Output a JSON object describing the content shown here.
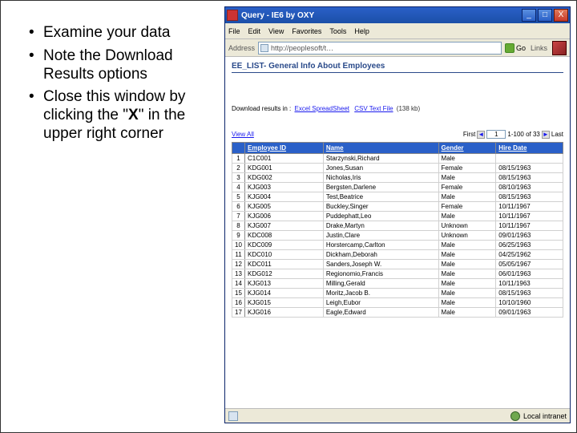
{
  "bullets": [
    "Examine your data",
    "Note the Download Results options",
    "Close this window by clicking the \"<b>X</b>\" in the upper right corner"
  ],
  "window": {
    "title": "Query - IE6 by OXY",
    "menu": [
      "File",
      "Edit",
      "View",
      "Favorites",
      "Tools",
      "Help"
    ],
    "addr_label": "Address",
    "url": "http://peoplesoft/t…",
    "go_label": "Go",
    "links_label": "Links"
  },
  "page": {
    "heading": "EE_LIST- General Info About Employees",
    "download_prefix": "Download results in :",
    "download_links": [
      "Excel SpreadSheet",
      "CSV Text File"
    ],
    "download_size": "(138 kb)",
    "view_all": "View All",
    "nav_label_first": "First",
    "nav_page_input": "1",
    "nav_range": "1-100 of 33",
    "nav_label_last": "Last",
    "columns": [
      "Employee ID",
      "Name",
      "Gender",
      "Hire Date"
    ],
    "rows": [
      {
        "n": 1,
        "id": "C1C001",
        "name": "Starzynski,Richard",
        "gender": "Male",
        "hire": ""
      },
      {
        "n": 2,
        "id": "KDG001",
        "name": "Jones,Susan",
        "gender": "Female",
        "hire": "08/15/1963"
      },
      {
        "n": 3,
        "id": "KDG002",
        "name": "Nicholas,Iris",
        "gender": "Male",
        "hire": "08/15/1963"
      },
      {
        "n": 4,
        "id": "KJG003",
        "name": "Bergsten,Darlene",
        "gender": "Female",
        "hire": "08/10/1963"
      },
      {
        "n": 5,
        "id": "KJG004",
        "name": "Test,Beatrice",
        "gender": "Male",
        "hire": "08/15/1963"
      },
      {
        "n": 6,
        "id": "KJG005",
        "name": "Buckley,Singer",
        "gender": "Female",
        "hire": "10/11/1967"
      },
      {
        "n": 7,
        "id": "KJG006",
        "name": "Puddephatt,Leo",
        "gender": "Male",
        "hire": "10/11/1967"
      },
      {
        "n": 8,
        "id": "KJG007",
        "name": "Drake,Martyn",
        "gender": "Unknown",
        "hire": "10/11/1967"
      },
      {
        "n": 9,
        "id": "KDC008",
        "name": "Justin,Clare",
        "gender": "Unknown",
        "hire": "09/01/1963"
      },
      {
        "n": 10,
        "id": "KDC009",
        "name": "Horstercamp,Carlton",
        "gender": "Male",
        "hire": "06/25/1963"
      },
      {
        "n": 11,
        "id": "KDC010",
        "name": "Dickham,Deborah",
        "gender": "Male",
        "hire": "04/25/1962"
      },
      {
        "n": 12,
        "id": "KDC011",
        "name": "Sanders,Joseph W.",
        "gender": "Male",
        "hire": "05/05/1967"
      },
      {
        "n": 13,
        "id": "KDG012",
        "name": "Regionomio,Francis",
        "gender": "Male",
        "hire": "06/01/1963"
      },
      {
        "n": 14,
        "id": "KJG013",
        "name": "Milling,Gerald",
        "gender": "Male",
        "hire": "10/11/1963"
      },
      {
        "n": 15,
        "id": "KJG014",
        "name": "Moritz,Jacob B.",
        "gender": "Male",
        "hire": "08/15/1963"
      },
      {
        "n": 16,
        "id": "KJG015",
        "name": "Leigh,Eubor",
        "gender": "Male",
        "hire": "10/10/1960"
      },
      {
        "n": 17,
        "id": "KJG016",
        "name": "Eagle,Edward",
        "gender": "Male",
        "hire": "09/01/1963"
      }
    ]
  },
  "status": {
    "zone": "Local intranet"
  }
}
